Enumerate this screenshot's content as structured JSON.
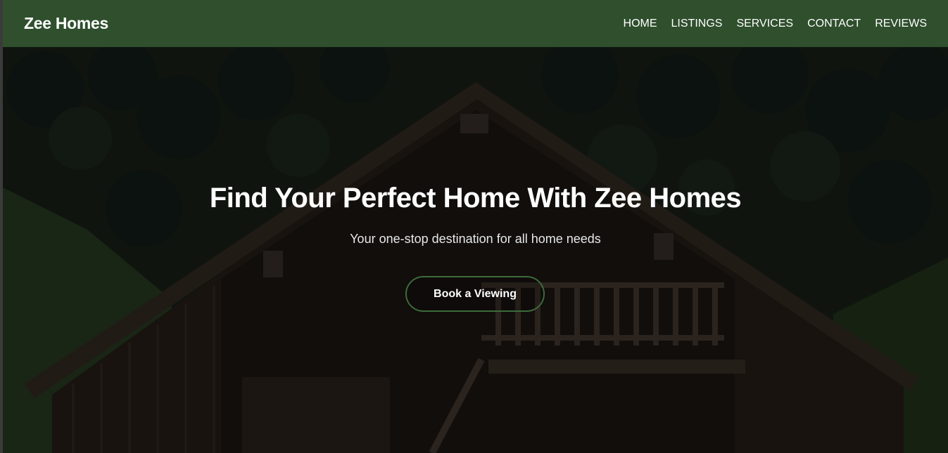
{
  "brand": {
    "name": "Zee Homes"
  },
  "nav": {
    "items": [
      {
        "label": "HOME"
      },
      {
        "label": "LISTINGS"
      },
      {
        "label": "SERVICES"
      },
      {
        "label": "CONTACT"
      },
      {
        "label": "REVIEWS"
      }
    ]
  },
  "hero": {
    "title": "Find Your Perfect Home With Zee Homes",
    "subtitle": "Your one-stop destination for all home needs",
    "cta_label": "Book a Viewing",
    "background_image": "wooden-cabin-forest-photo"
  },
  "colors": {
    "navbar_bg": "#2f4f2d",
    "cta_border": "#3d6b3a",
    "text": "#ffffff"
  }
}
